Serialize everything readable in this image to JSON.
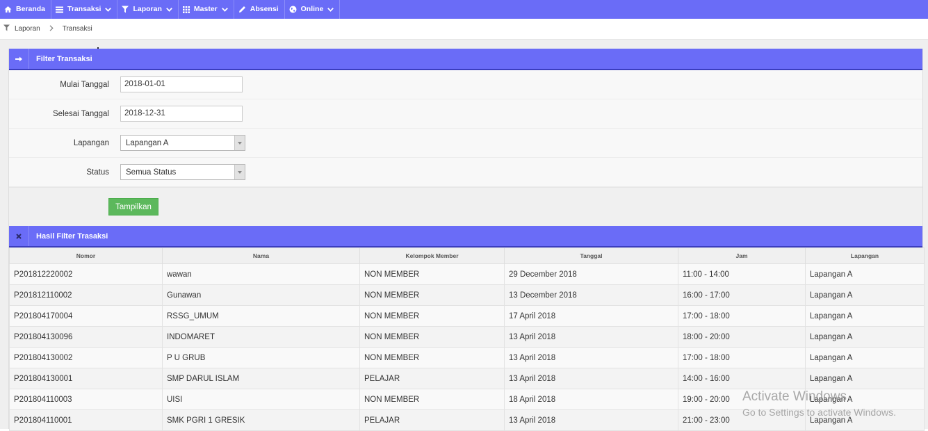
{
  "nav": {
    "items": [
      {
        "label": "Beranda",
        "icon": "home-icon",
        "has_dropdown": false
      },
      {
        "label": "Transaksi",
        "icon": "list-icon",
        "has_dropdown": true
      },
      {
        "label": "Laporan",
        "icon": "filter-icon",
        "has_dropdown": true
      },
      {
        "label": "Master",
        "icon": "grid-icon",
        "has_dropdown": true
      },
      {
        "label": "Absensi",
        "icon": "pencil-icon",
        "has_dropdown": false
      },
      {
        "label": "Online",
        "icon": "globe-icon",
        "has_dropdown": true
      }
    ],
    "background": "#6a6cf7"
  },
  "breadcrumb": {
    "items": [
      "Laporan",
      "Transaksi"
    ]
  },
  "filter": {
    "title": "Filter Transaksi",
    "mulai_label": "Mulai Tanggal",
    "mulai_value": "2018-01-01",
    "selesai_label": "Selesai Tanggal",
    "selesai_value": "2018-12-31",
    "lapangan_label": "Lapangan",
    "lapangan_value": "Lapangan A",
    "status_label": "Status",
    "status_value": "Semua Status",
    "submit_label": "Tampilkan",
    "submit_color": "#5cb85c"
  },
  "result": {
    "title": "Hasil Filter Trasaksi",
    "columns": [
      "Nomor",
      "Nama",
      "Kelompok Member",
      "Tanggal",
      "Jam",
      "Lapangan"
    ],
    "rows": [
      [
        "P201812220002",
        "wawan",
        "NON MEMBER",
        "29 December 2018",
        "11:00 - 14:00",
        "Lapangan A"
      ],
      [
        "P201812110002",
        "Gunawan",
        "NON MEMBER",
        "13 December 2018",
        "16:00 - 17:00",
        "Lapangan A"
      ],
      [
        "P201804170004",
        "RSSG_UMUM",
        "NON MEMBER",
        "17 April 2018",
        "17:00 - 18:00",
        "Lapangan A"
      ],
      [
        "P201804130096",
        "INDOMARET",
        "NON MEMBER",
        "13 April 2018",
        "18:00 - 20:00",
        "Lapangan A"
      ],
      [
        "P201804130002",
        "P U GRUB",
        "NON MEMBER",
        "13 April 2018",
        "17:00 - 18:00",
        "Lapangan A"
      ],
      [
        "P201804130001",
        "SMP DARUL ISLAM",
        "PELAJAR",
        "13 April 2018",
        "14:00 - 16:00",
        "Lapangan A"
      ],
      [
        "P201804110003",
        "UISI",
        "NON MEMBER",
        "18 April 2018",
        "19:00 - 20:00",
        "Lapangan A"
      ],
      [
        "P201804110001",
        "SMK PGRI 1 GRESIK",
        "PELAJAR",
        "13 April 2018",
        "21:00 - 23:00",
        "Lapangan A"
      ]
    ]
  },
  "watermark": {
    "line1": "Activate Windows",
    "line2": "Go to Settings to activate Windows."
  }
}
